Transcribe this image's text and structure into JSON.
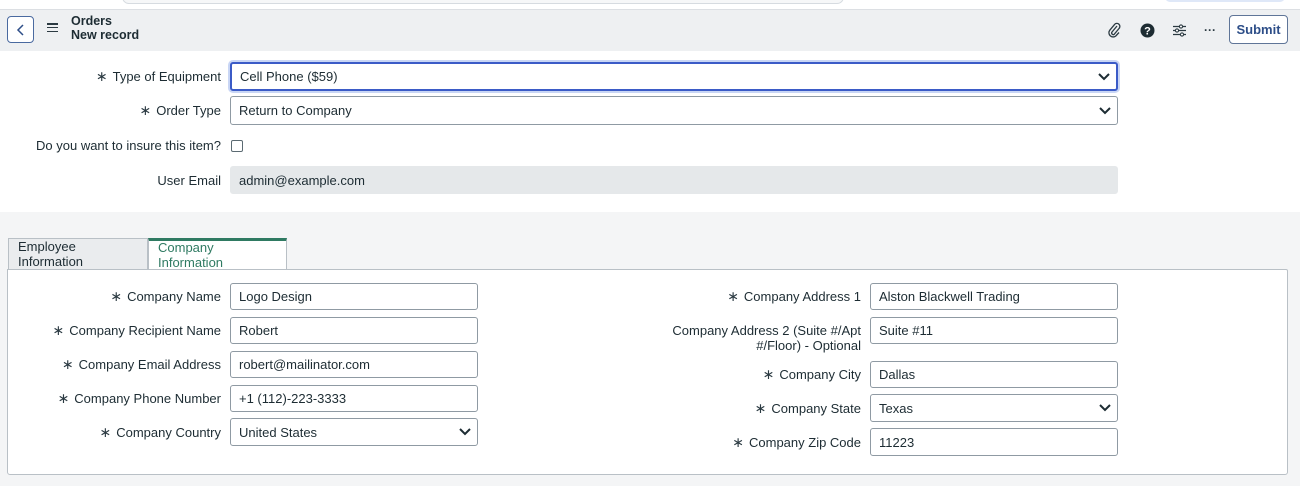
{
  "header": {
    "title": "Orders",
    "subtitle": "New record",
    "submit_label": "Submit",
    "more_label": "···"
  },
  "form": {
    "type_of_equipment": {
      "label": "Type of Equipment",
      "value": "Cell Phone ($59)"
    },
    "order_type": {
      "label": "Order Type",
      "value": "Return to Company"
    },
    "insure": {
      "label": "Do you want to insure this item?",
      "checked": false
    },
    "user_email": {
      "label": "User Email",
      "value": "admin@example.com"
    }
  },
  "tabs": [
    {
      "label": "Employee Information",
      "active": false
    },
    {
      "label": "Company Information",
      "active": true
    }
  ],
  "company": {
    "name": {
      "label": "Company Name",
      "value": "Logo Design"
    },
    "recipient": {
      "label": "Company Recipient Name",
      "value": "Robert"
    },
    "email": {
      "label": "Company Email Address",
      "value": "robert@mailinator.com"
    },
    "phone": {
      "label": "Company Phone Number",
      "value": "+1 (112)-223-3333"
    },
    "country": {
      "label": "Company Country",
      "value": "United States"
    },
    "address1": {
      "label": "Company Address 1",
      "value": "Alston Blackwell Trading"
    },
    "address2": {
      "label_line1": "Company Address 2 (Suite #/Apt",
      "label_line2": "#/Floor) - Optional",
      "value": "Suite #11"
    },
    "city": {
      "label": "Company City",
      "value": "Dallas"
    },
    "state": {
      "label": "Company State",
      "value": "Texas"
    },
    "zip": {
      "label": "Company Zip Code",
      "value": "11223"
    }
  },
  "required_marker": "∗",
  "colors": {
    "accent": "#2f7a62",
    "focus": "#3b5bc7",
    "header_bg": "#eef0f2"
  }
}
